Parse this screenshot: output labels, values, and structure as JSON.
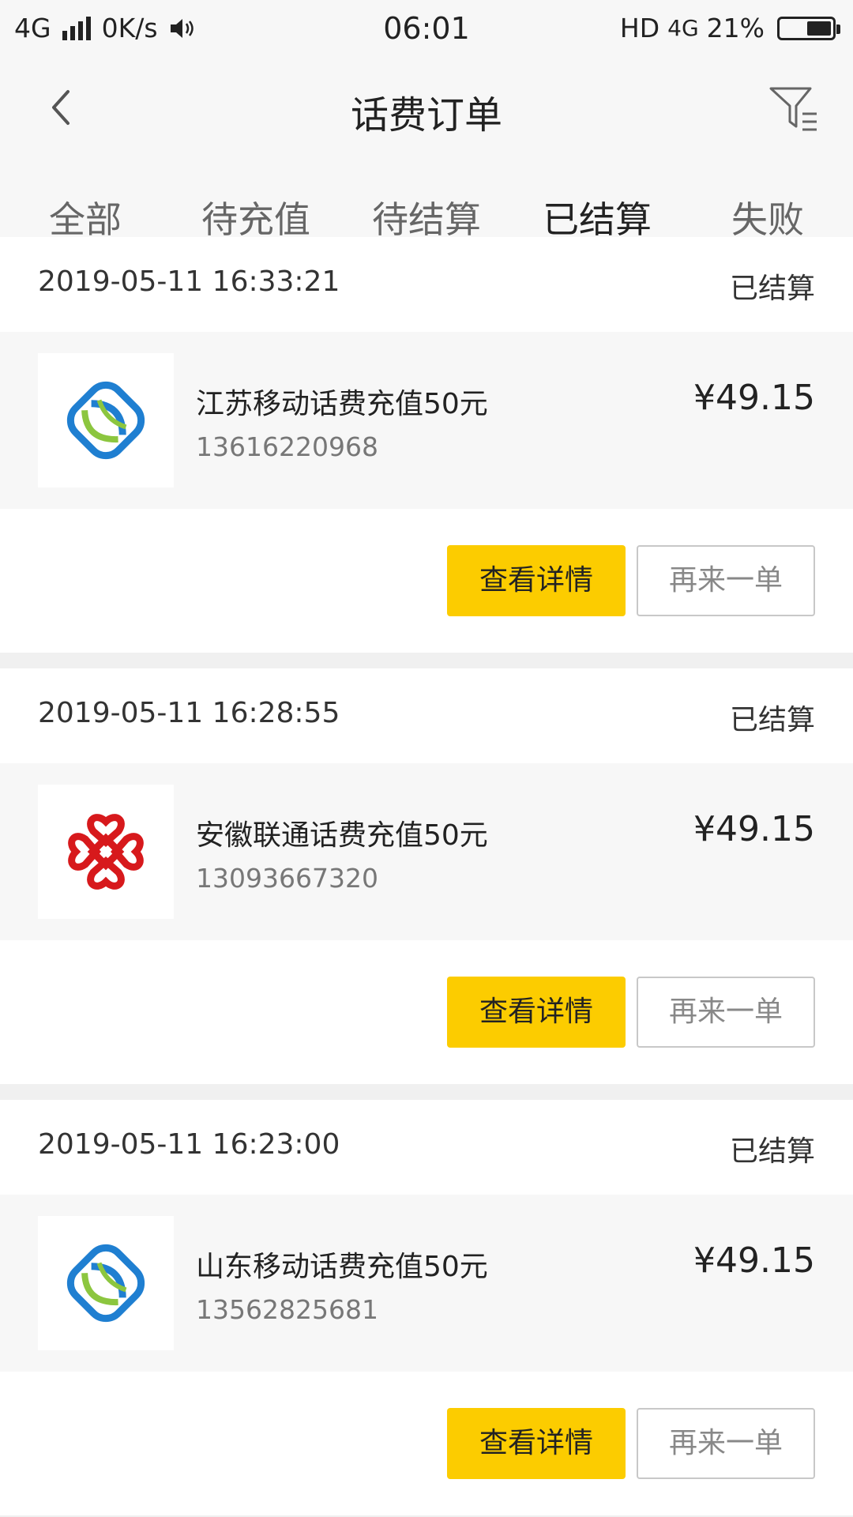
{
  "status_bar": {
    "network": "4G",
    "speed": "0K/s",
    "time": "06:01",
    "hd": "HD",
    "network_right": "4G",
    "battery": "21%"
  },
  "header": {
    "title": "话费订单"
  },
  "tabs": [
    {
      "label": "全部"
    },
    {
      "label": "待充值"
    },
    {
      "label": "待结算"
    },
    {
      "label": "已结算"
    },
    {
      "label": "失败"
    }
  ],
  "orders": [
    {
      "date": "2019-05-11 16:33:21",
      "status": "已结算",
      "product": "江苏移动话费充值50元",
      "phone": "13616220968",
      "price": "¥49.15",
      "carrier_icon": "china-mobile-logo-icon",
      "detail_label": "查看详情",
      "again_label": "再来一单"
    },
    {
      "date": "2019-05-11 16:28:55",
      "status": "已结算",
      "product": "安徽联通话费充值50元",
      "phone": "13093667320",
      "price": "¥49.15",
      "carrier_icon": "china-unicom-logo-icon",
      "detail_label": "查看详情",
      "again_label": "再来一单"
    },
    {
      "date": "2019-05-11 16:23:00",
      "status": "已结算",
      "product": "山东移动话费充值50元",
      "phone": "13562825681",
      "price": "¥49.15",
      "carrier_icon": "china-mobile-logo-icon",
      "detail_label": "查看详情",
      "again_label": "再来一单"
    }
  ],
  "colors": {
    "accent": "#fccc00",
    "tab_underline": "#f5b800",
    "mobile_blue": "#1f7fd1",
    "mobile_green": "#8cc63f",
    "unicom_red": "#d7191c"
  }
}
